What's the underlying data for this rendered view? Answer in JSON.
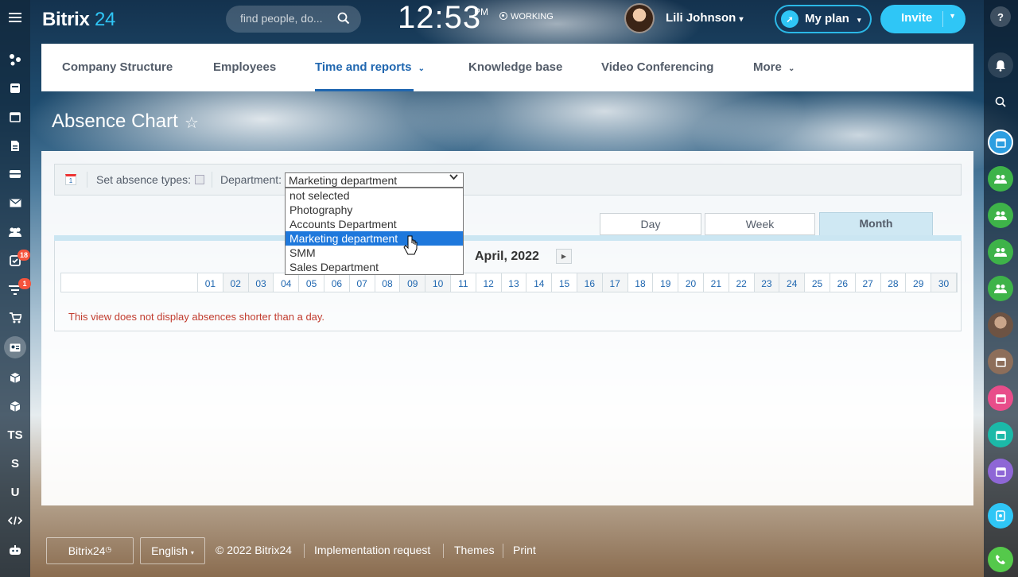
{
  "header": {
    "logo_text": "Bitrix",
    "logo_num": "24",
    "search_placeholder": "find people, do...",
    "clock_time": "12:53",
    "clock_ampm": "PM",
    "work_status": "WORKING",
    "user_name": "Lili Johnson",
    "myplan_label": "My plan",
    "invite_label": "Invite"
  },
  "left_sidebar": {
    "tasks_badge": "18",
    "filter_badge": "1",
    "text_items": [
      "TS",
      "S",
      "U"
    ]
  },
  "navbar": {
    "tabs": [
      "Company Structure",
      "Employees",
      "Time and reports",
      "Knowledge base",
      "Video Conferencing",
      "More"
    ],
    "active_tab": "Time and reports"
  },
  "page": {
    "title": "Absence Chart"
  },
  "filter": {
    "calendar_icon_day": "1",
    "absence_types_label": "Set absence types:",
    "department_label": "Department:",
    "department_selected": "Marketing department",
    "department_options": [
      "not selected",
      "Photography",
      "Accounts Department",
      "Marketing department",
      "SMM",
      "Sales Department"
    ]
  },
  "view_tabs": [
    "Day",
    "Week",
    "Month"
  ],
  "active_view": "Month",
  "calendar": {
    "month_label": "April, 2022",
    "days": [
      "01",
      "02",
      "03",
      "04",
      "05",
      "06",
      "07",
      "08",
      "09",
      "10",
      "11",
      "12",
      "13",
      "14",
      "15",
      "16",
      "17",
      "18",
      "19",
      "20",
      "21",
      "22",
      "23",
      "24",
      "25",
      "26",
      "27",
      "28",
      "29",
      "30"
    ],
    "weekend_days": [
      "02",
      "03",
      "09",
      "10",
      "16",
      "17",
      "23",
      "24",
      "30"
    ],
    "note": "This view does not display absences shorter than a day."
  },
  "footer": {
    "brand": "Bitrix24",
    "language": "English",
    "copyright": "© 2022 Bitrix24",
    "links": [
      "Implementation request",
      "Themes",
      "Print"
    ]
  },
  "colors": {
    "accent": "#2fc6f6",
    "active_tab": "#2067b0",
    "selected_option": "#1e78dc",
    "note_text": "#c13b2e"
  }
}
